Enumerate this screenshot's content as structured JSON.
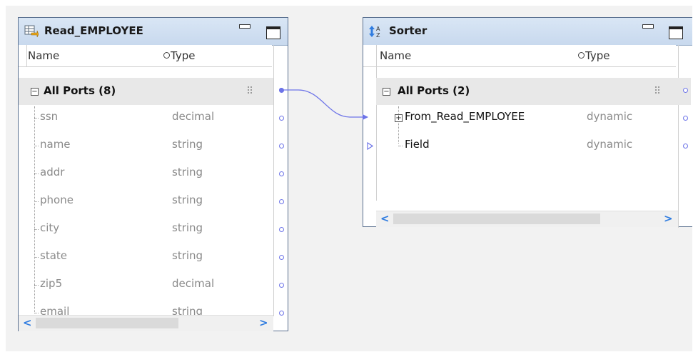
{
  "canvas": {
    "background": "#f2f2f2"
  },
  "read_employee": {
    "title": "Read_EMPLOYEE",
    "icon": "read-source-icon",
    "columns": {
      "name": "Name",
      "type": "Type"
    },
    "group": {
      "label": "All Ports (8)"
    },
    "ports": [
      {
        "name": "ssn",
        "type": "decimal"
      },
      {
        "name": "name",
        "type": "string"
      },
      {
        "name": "addr",
        "type": "string"
      },
      {
        "name": "phone",
        "type": "string"
      },
      {
        "name": "city",
        "type": "string"
      },
      {
        "name": "state",
        "type": "string"
      },
      {
        "name": "zip5",
        "type": "decimal"
      },
      {
        "name": "email",
        "type": "string"
      }
    ],
    "scroll": {
      "left": "<",
      "right": ">"
    }
  },
  "sorter": {
    "title": "Sorter",
    "icon": "sort-az-icon",
    "columns": {
      "name": "Name",
      "type": "Type"
    },
    "group": {
      "label": "All Ports (2)"
    },
    "ports": [
      {
        "name": "From_Read_EMPLOYEE",
        "type": "dynamic"
      },
      {
        "name": "Field",
        "type": "dynamic"
      }
    ],
    "scroll": {
      "left": "<",
      "right": ">"
    }
  },
  "colors": {
    "link": "#6d74e8",
    "title_bg": "#c8d9ee",
    "scroll_arrow": "#2f7ce0"
  }
}
